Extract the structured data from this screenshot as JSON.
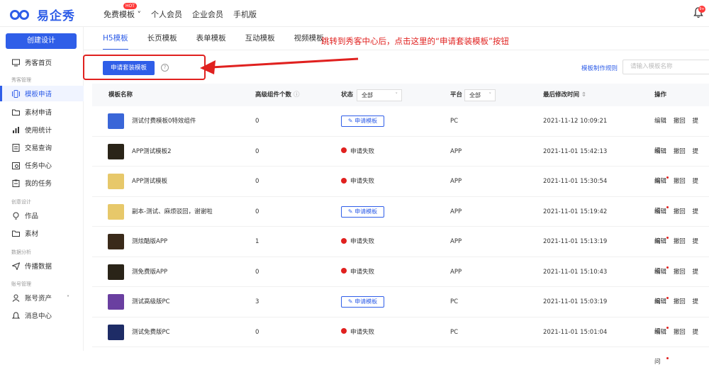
{
  "header": {
    "logo_text": "易企秀",
    "nav": [
      {
        "label": "免费模板",
        "badge": "HOT"
      },
      {
        "label": "个人会员"
      },
      {
        "label": "企业会员"
      },
      {
        "label": "手机版"
      }
    ],
    "notification_badge": "9+"
  },
  "sidebar": {
    "create_button": "创建设计",
    "sections": {
      "manage": "秀客管理",
      "creative": "创意设计",
      "analysis": "数据分析",
      "account": "账号管理"
    },
    "items": [
      {
        "label": "秀客首页",
        "icon": "monitor-icon"
      },
      {
        "label": "模板申请",
        "icon": "template-icon",
        "active": true
      },
      {
        "label": "素材申请",
        "icon": "folder-icon"
      },
      {
        "label": "使用统计",
        "icon": "bar-chart-icon"
      },
      {
        "label": "交易查询",
        "icon": "document-icon"
      },
      {
        "label": "任务中心",
        "icon": "task-icon"
      },
      {
        "label": "我的任务",
        "icon": "clipboard-icon"
      },
      {
        "label": "作品",
        "icon": "bulb-icon"
      },
      {
        "label": "素材",
        "icon": "folder-icon"
      },
      {
        "label": "传播数据",
        "icon": "send-icon"
      },
      {
        "label": "账号资产",
        "icon": "user-icon"
      },
      {
        "label": "消息中心",
        "icon": "bell-icon"
      }
    ]
  },
  "tabs": [
    "H5模板",
    "长页模板",
    "表单模板",
    "互动模板",
    "视频模板"
  ],
  "annotation": "跳转到秀客中心后，点击这里的“申请套装模板”按钮",
  "toolbar": {
    "apply_suite_button": "申请套装模板",
    "rules_link": "模板制作规则",
    "search_placeholder": "请输入模板名称"
  },
  "table": {
    "headers": {
      "name": "模板名称",
      "advanced_count": "高级组件个数",
      "status": "状态",
      "status_filter": "全部",
      "platform": "平台",
      "platform_filter": "全部",
      "modified": "最后修改时间",
      "actions": "操作"
    },
    "action_labels": [
      "编辑",
      "撤回",
      "提问"
    ],
    "rows": [
      {
        "name": "测试付费模板0特效组件",
        "count": "0",
        "status": "申请模板",
        "status_type": "button",
        "platform": "PC",
        "time": "2021-11-12 10:09:21",
        "thumb": "#3a66d8",
        "dot": false
      },
      {
        "name": "APP测试模板2",
        "count": "0",
        "status": "申请失败",
        "status_type": "fail",
        "platform": "APP",
        "time": "2021-11-01 15:42:13",
        "thumb": "#2a2418",
        "dot": true
      },
      {
        "name": "APP测试模板",
        "count": "0",
        "status": "申请失败",
        "status_type": "fail",
        "platform": "APP",
        "time": "2021-11-01 15:30:54",
        "thumb": "#e7c86a",
        "dot": true
      },
      {
        "name": "副本-测试、麻烦驳回，谢谢啦",
        "count": "0",
        "status": "申请模板",
        "status_type": "button",
        "platform": "APP",
        "time": "2021-11-01 15:19:42",
        "thumb": "#e7c86a",
        "dot": true
      },
      {
        "name": "测炫酷版APP",
        "count": "1",
        "status": "申请失败",
        "status_type": "fail",
        "platform": "APP",
        "time": "2021-11-01 15:13:19",
        "thumb": "#3a2a1a",
        "dot": true
      },
      {
        "name": "测免费版APP",
        "count": "0",
        "status": "申请失败",
        "status_type": "fail",
        "platform": "APP",
        "time": "2021-11-01 15:10:43",
        "thumb": "#2a2418",
        "dot": true
      },
      {
        "name": "测试高级版PC",
        "count": "3",
        "status": "申请模板",
        "status_type": "button",
        "platform": "PC",
        "time": "2021-11-01 15:03:19",
        "thumb": "#6a3fa0",
        "dot": true
      },
      {
        "name": "测试免费版PC",
        "count": "0",
        "status": "申请失败",
        "status_type": "fail",
        "platform": "PC",
        "time": "2021-11-01 15:01:04",
        "thumb": "#1e2c66",
        "dot": true
      }
    ]
  },
  "colors": {
    "accent": "#2f5ee8",
    "alert": "#e0211f"
  }
}
